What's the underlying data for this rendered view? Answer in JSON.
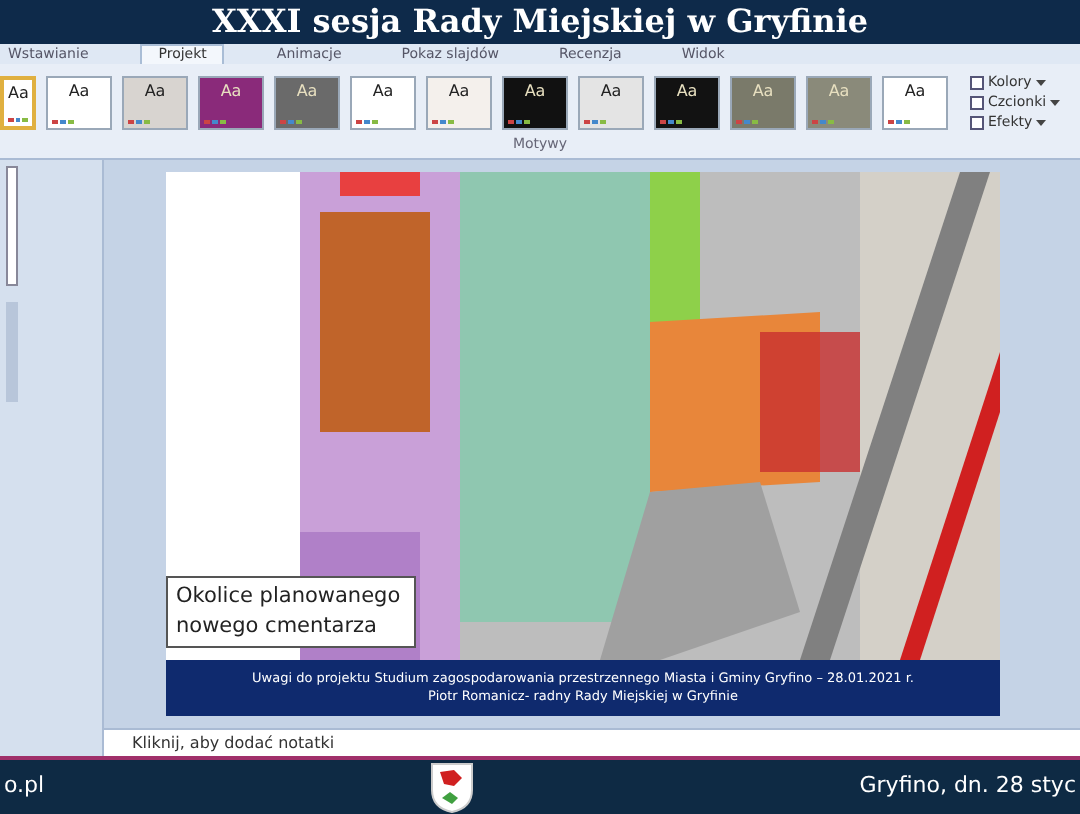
{
  "banner": {
    "title": "XXXI sesja Rady Miejskiej w Gryfinie"
  },
  "ribbon_tabs": [
    {
      "label": "Wstawianie",
      "selected": false
    },
    {
      "label": "Projekt",
      "selected": true
    },
    {
      "label": "Animacje",
      "selected": false
    },
    {
      "label": "Pokaz slajdów",
      "selected": false
    },
    {
      "label": "Recenzja",
      "selected": false
    },
    {
      "label": "Widok",
      "selected": false
    }
  ],
  "themes": [
    {
      "label": "Aa",
      "color": "#ffffff",
      "selected": true
    },
    {
      "label": "Aa",
      "color": "#ffffff",
      "selected": false
    },
    {
      "label": "Aa",
      "color": "#d8d4d0",
      "selected": false
    },
    {
      "label": "Aa",
      "color": "#8a2a7a",
      "selected": false
    },
    {
      "label": "Aa",
      "color": "#6a6a6a",
      "selected": false
    },
    {
      "label": "Aa",
      "color": "#ffffff",
      "selected": false
    },
    {
      "label": "Aa",
      "color": "#f4f0ec",
      "selected": false
    },
    {
      "label": "Aa",
      "color": "#111111",
      "selected": false
    },
    {
      "label": "Aa",
      "color": "#e4e4e4",
      "selected": false
    },
    {
      "label": "Aa",
      "color": "#121212",
      "selected": false
    },
    {
      "label": "Aa",
      "color": "#7a7a6a",
      "selected": false
    },
    {
      "label": "Aa",
      "color": "#8a8a7a",
      "selected": false
    },
    {
      "label": "Aa",
      "color": "#ffffff",
      "selected": false
    }
  ],
  "theme_options": [
    "Kolory",
    "Czcionki",
    "Efekty"
  ],
  "group_label": "Motywy",
  "slide": {
    "callout": "Okolice planowanego nowego cmentarza",
    "footer_line_1": "Uwagi do projektu Studium  zagospodarowania  przestrzennego Miasta i Gminy Gryfino – 28.01.2021 r.",
    "footer_line_2": "Piotr Romanicz- radny Rady Miejskiej w Gryfinie"
  },
  "notes_placeholder": "Kliknij, aby dodać notatki",
  "lower_banner": {
    "left": "o.pl",
    "right": "Gryfino, dn. 28 styc"
  }
}
